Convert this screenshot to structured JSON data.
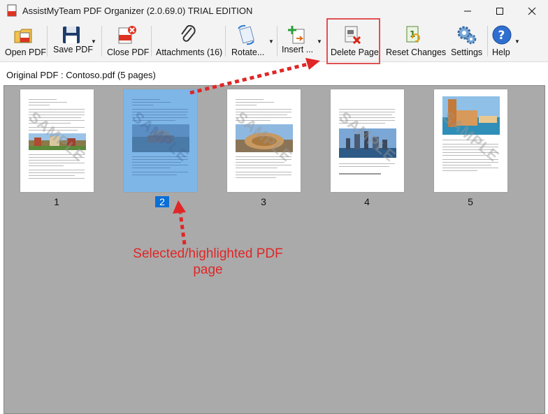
{
  "window": {
    "title": "AssistMyTeam PDF Organizer (2.0.69.0) TRIAL EDITION"
  },
  "toolbar": {
    "open_pdf": "Open PDF",
    "save_pdf": "Save PDF",
    "close_pdf": "Close PDF",
    "attachments": "Attachments (16)",
    "rotate": "Rotate...",
    "insert": "Insert ...",
    "delete_page": "Delete Page",
    "reset_changes": "Reset Changes",
    "settings": "Settings",
    "help": "Help"
  },
  "document": {
    "label": "Original PDF : Contoso.pdf (5 pages)",
    "pages": [
      {
        "number": "1",
        "watermark": "SAMPLE"
      },
      {
        "number": "2",
        "watermark": "SAMPLE",
        "selected": true
      },
      {
        "number": "3",
        "watermark": "SAMPLE"
      },
      {
        "number": "4",
        "watermark": "SAMPLE"
      },
      {
        "number": "5",
        "watermark": "SAMPLE"
      }
    ]
  },
  "annotation": {
    "text": "Selected/highlighted PDF page"
  },
  "colors": {
    "annotation_red": "#e02626",
    "selection_blue": "#0a6fd6",
    "panel_gray": "#aaaaaa"
  }
}
